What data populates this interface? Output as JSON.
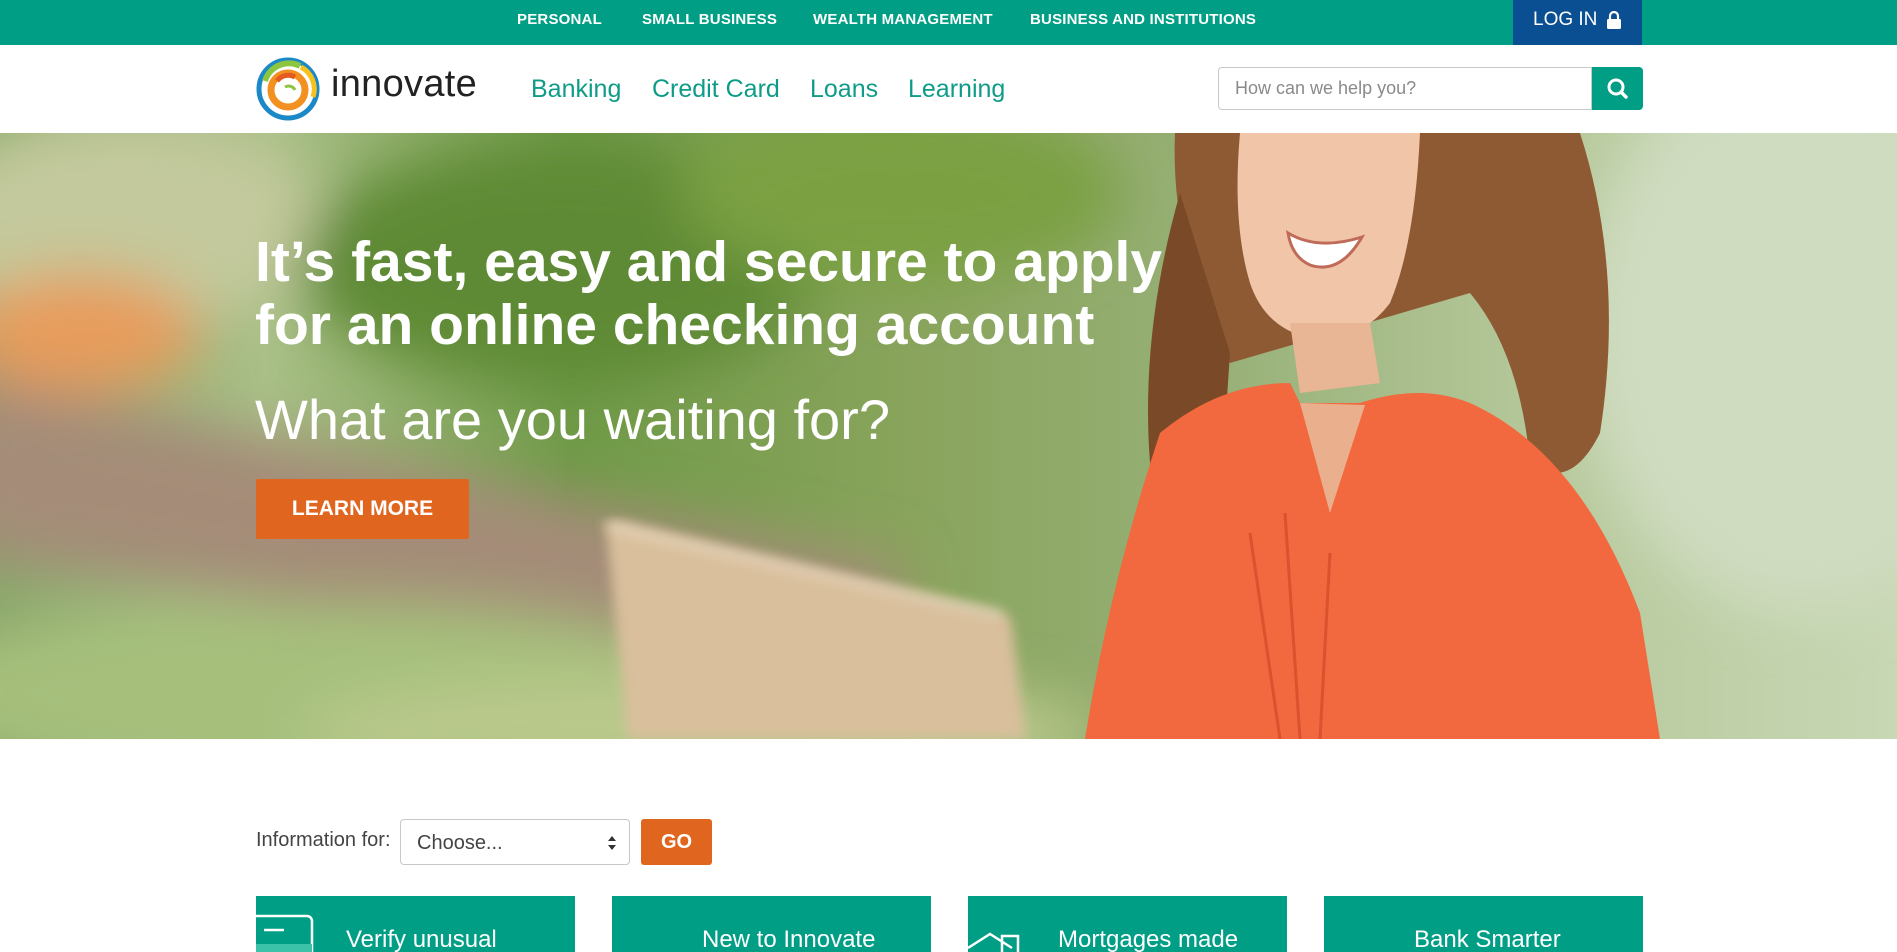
{
  "topbar": {
    "items": [
      "PERSONAL",
      "SMALL BUSINESS",
      "WEALTH MANAGEMENT",
      "BUSINESS AND INSTITUTIONS"
    ],
    "login_label": "LOG IN",
    "login_icon": "lock-icon"
  },
  "header": {
    "logo_text": "innovate",
    "nav": [
      "Banking",
      "Credit Card",
      "Loans",
      "Learning"
    ],
    "search": {
      "placeholder": "How can we help you?",
      "value": "",
      "icon": "search-icon"
    }
  },
  "hero": {
    "title": "It’s fast, easy and secure to apply for an online checking account",
    "subtitle": "What are you waiting for?",
    "cta_label": "LEARN MORE"
  },
  "info_for": {
    "label": "Information for:",
    "selected": "Choose...",
    "go_label": "GO"
  },
  "tiles": [
    {
      "label": "Verify unusual",
      "icon": "card-icon"
    },
    {
      "label": "New to Innovate",
      "icon": ""
    },
    {
      "label": "Mortgages made",
      "icon": "house-icon"
    },
    {
      "label": "Bank Smarter",
      "icon": ""
    }
  ],
  "colors": {
    "brand_teal": "#009e85",
    "login_blue": "#0a4f92",
    "accent_orange": "#e0661f",
    "nav_text": "#0e9c88"
  }
}
